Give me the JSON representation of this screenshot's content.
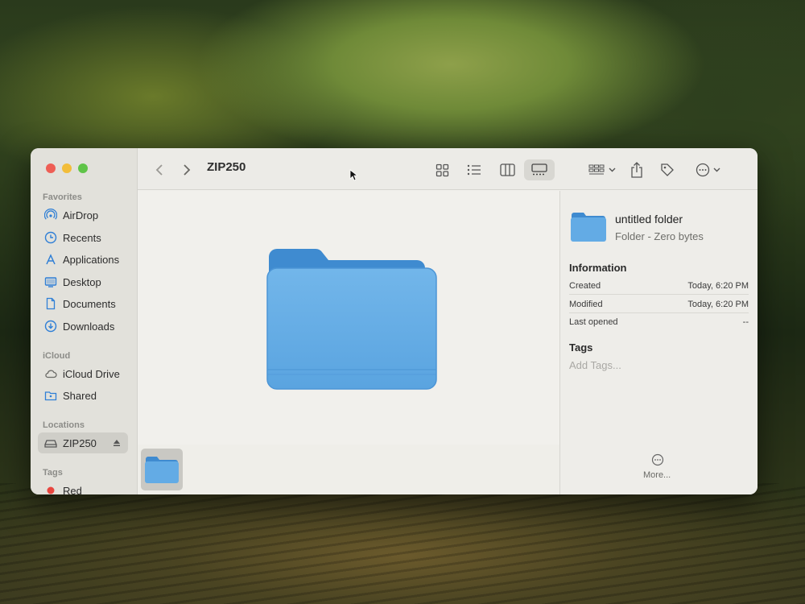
{
  "window": {
    "title": "ZIP250"
  },
  "sidebar": {
    "favorites_header": "Favorites",
    "favorites": [
      {
        "label": "AirDrop",
        "icon": "airdrop-icon"
      },
      {
        "label": "Recents",
        "icon": "clock-icon"
      },
      {
        "label": "Applications",
        "icon": "applications-icon"
      },
      {
        "label": "Desktop",
        "icon": "desktop-icon"
      },
      {
        "label": "Documents",
        "icon": "document-icon"
      },
      {
        "label": "Downloads",
        "icon": "download-icon"
      }
    ],
    "icloud_header": "iCloud",
    "icloud": [
      {
        "label": "iCloud Drive",
        "icon": "cloud-icon"
      },
      {
        "label": "Shared",
        "icon": "shared-folder-icon"
      }
    ],
    "locations_header": "Locations",
    "locations": [
      {
        "label": "ZIP250",
        "icon": "drive-icon",
        "selected": true
      }
    ],
    "tags_header": "Tags",
    "tags": [
      {
        "label": "Red",
        "color": "#e8463f"
      }
    ]
  },
  "toolbar": {
    "active_view": "gallery",
    "views": [
      "icon-view",
      "list-view",
      "column-view",
      "gallery-view"
    ]
  },
  "inspector": {
    "name": "untitled folder",
    "kind": "Folder - Zero bytes",
    "information_header": "Information",
    "rows": [
      {
        "label": "Created",
        "value": "Today, 6:20 PM"
      },
      {
        "label": "Modified",
        "value": "Today, 6:20 PM"
      },
      {
        "label": "Last opened",
        "value": "--"
      }
    ],
    "tags_header": "Tags",
    "tags_placeholder": "Add Tags...",
    "more_label": "More..."
  },
  "colors": {
    "folder_blue": "#5ea8e4",
    "folder_blue_dark": "#3f8bd0",
    "sidebar_icon_blue": "#2f7fd6"
  }
}
